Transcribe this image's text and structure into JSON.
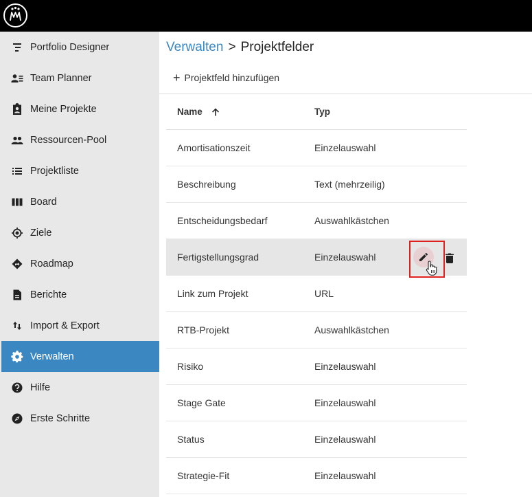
{
  "app": {
    "logo_icon": "mm-logo-icon"
  },
  "sidebar": {
    "items": [
      {
        "label": "Portfolio Designer",
        "icon": "portfolio-designer-icon"
      },
      {
        "label": "Team Planner",
        "icon": "team-planner-icon"
      },
      {
        "label": "Meine Projekte",
        "icon": "clipboard-person-icon"
      },
      {
        "label": "Ressourcen-Pool",
        "icon": "people-icon"
      },
      {
        "label": "Projektliste",
        "icon": "list-icon"
      },
      {
        "label": "Board",
        "icon": "board-columns-icon"
      },
      {
        "label": "Ziele",
        "icon": "target-icon"
      },
      {
        "label": "Roadmap",
        "icon": "roadmap-diamond-icon"
      },
      {
        "label": "Berichte",
        "icon": "document-icon"
      },
      {
        "label": "Import & Export",
        "icon": "import-export-icon"
      },
      {
        "label": "Verwalten",
        "icon": "gear-icon",
        "active": true
      },
      {
        "label": "Hilfe",
        "icon": "help-icon"
      },
      {
        "label": "Erste Schritte",
        "icon": "compass-icon"
      }
    ],
    "active_color": "#3a87c2"
  },
  "breadcrumb": {
    "parent": "Verwalten",
    "separator": ">",
    "current": "Projektfelder"
  },
  "toolbar": {
    "add_label": "Projektfeld hinzufügen",
    "add_icon": "plus-icon"
  },
  "table": {
    "headers": {
      "name": "Name",
      "type": "Typ",
      "sort_icon": "arrow-up-icon"
    },
    "rows": [
      {
        "name": "Amortisationszeit",
        "type": "Einzelauswahl"
      },
      {
        "name": "Beschreibung",
        "type": "Text (mehrzeilig)"
      },
      {
        "name": "Entscheidungsbedarf",
        "type": "Auswahlkästchen"
      },
      {
        "name": "Fertigstellungsgrad",
        "type": "Einzelauswahl",
        "hovered": true
      },
      {
        "name": "Link zum Projekt",
        "type": "URL"
      },
      {
        "name": "RTB-Projekt",
        "type": "Auswahlkästchen"
      },
      {
        "name": "Risiko",
        "type": "Einzelauswahl"
      },
      {
        "name": "Stage Gate",
        "type": "Einzelauswahl"
      },
      {
        "name": "Status",
        "type": "Einzelauswahl"
      },
      {
        "name": "Strategie-Fit",
        "type": "Einzelauswahl"
      }
    ],
    "row_actions": {
      "edit_icon": "pencil-icon",
      "delete_icon": "trash-icon"
    }
  }
}
